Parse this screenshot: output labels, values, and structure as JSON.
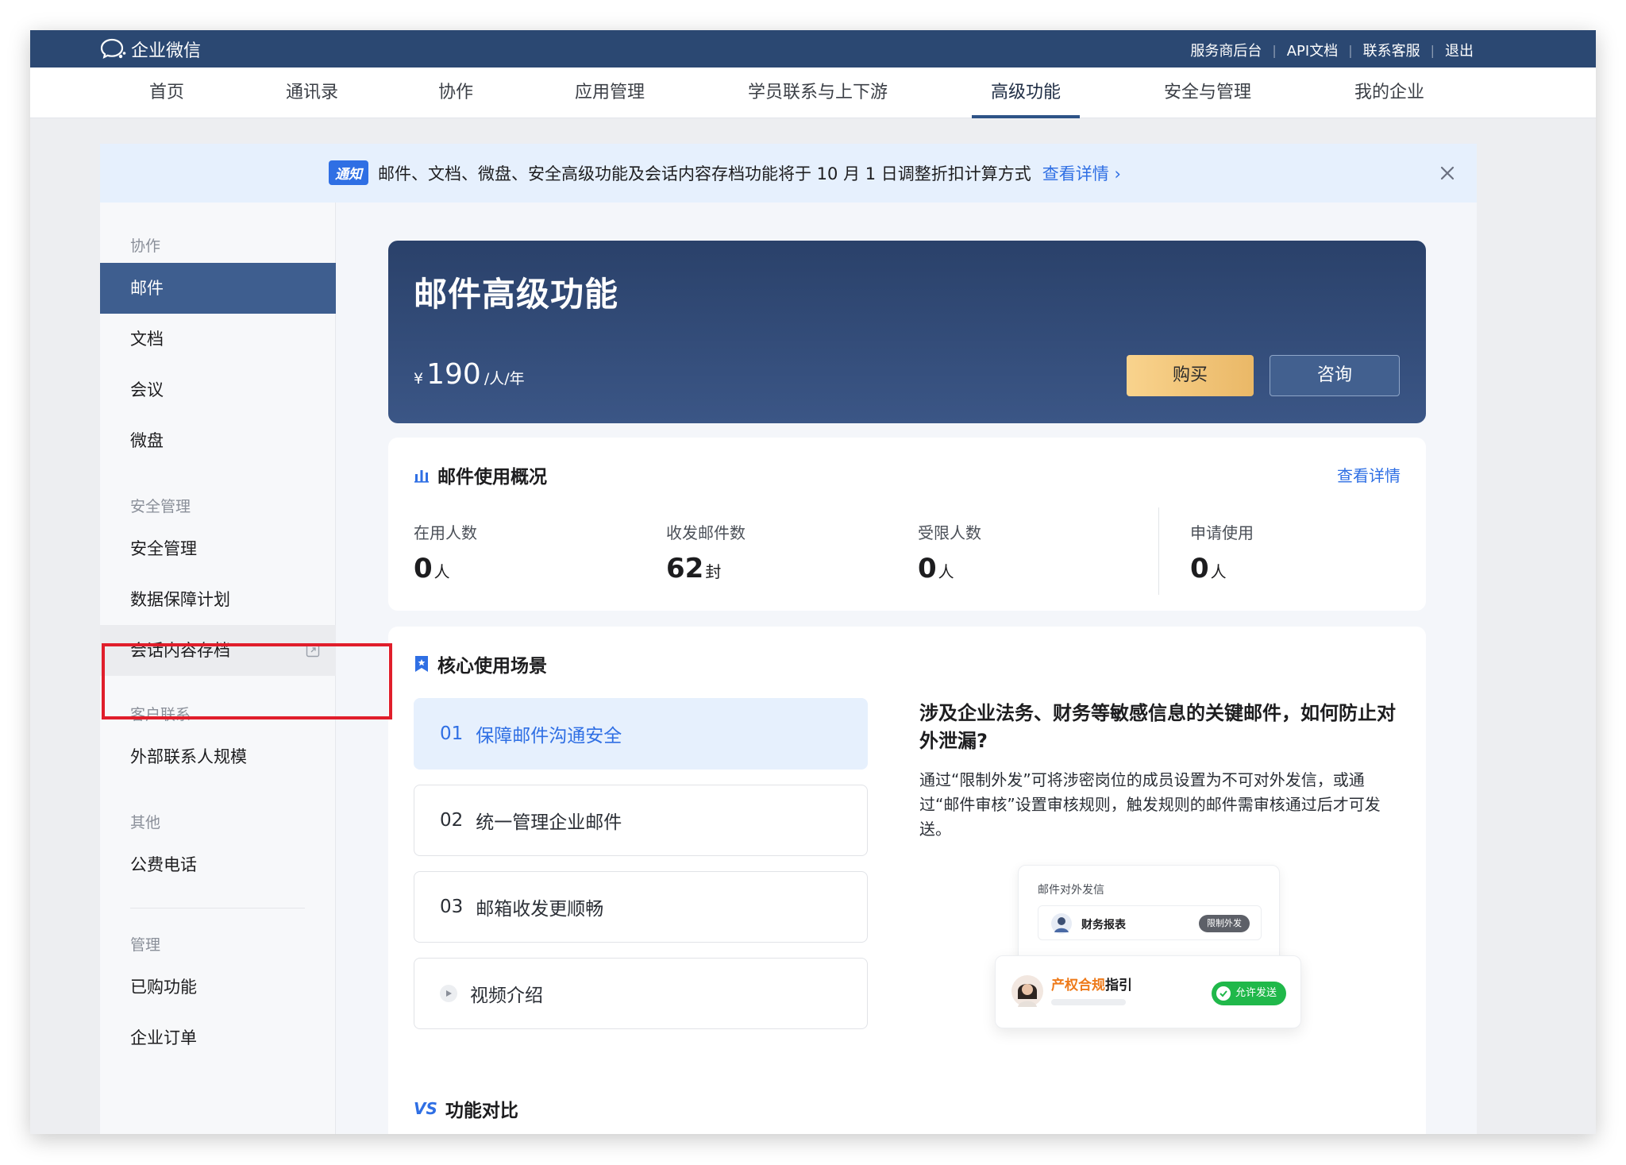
{
  "app": {
    "brand": "企业微信",
    "top_links": [
      "服务商后台",
      "API文档",
      "联系客服",
      "退出"
    ]
  },
  "nav": {
    "items": [
      "首页",
      "通讯录",
      "协作",
      "应用管理",
      "学员联系与上下游",
      "高级功能",
      "安全与管理",
      "我的企业"
    ],
    "active": "高级功能"
  },
  "notice": {
    "badge": "通知",
    "text": "邮件、文档、微盘、安全高级功能及会话内容存档功能将于 10 月 1 日调整折扣计算方式",
    "link": "查看详情"
  },
  "sidebar": {
    "groups": {
      "collab": "协作",
      "security": "安全管理",
      "customer": "客户联系",
      "other": "其他",
      "manage": "管理"
    },
    "items": {
      "mail": "邮件",
      "docs": "文档",
      "meeting": "会议",
      "drive": "微盘",
      "security_mgmt": "安全管理",
      "data_protect": "数据保障计划",
      "archive": "会话内容存档",
      "external_contacts": "外部联系人规模",
      "public_phone": "公费电话",
      "purchased": "已购功能",
      "orders": "企业订单"
    }
  },
  "hero": {
    "title": "邮件高级功能",
    "currency": "¥",
    "price": "190",
    "unit": "/人/年",
    "buy": "购买",
    "consult": "咨询"
  },
  "usage": {
    "title": "邮件使用概况",
    "link": "查看详情",
    "stats": [
      {
        "label": "在用人数",
        "value": "0",
        "unit": "人"
      },
      {
        "label": "收发邮件数",
        "value": "62",
        "unit": "封"
      },
      {
        "label": "受限人数",
        "value": "0",
        "unit": "人"
      },
      {
        "label": "申请使用",
        "value": "0",
        "unit": "人"
      }
    ]
  },
  "scenarios": {
    "title": "核心使用场景",
    "items": [
      {
        "num": "01",
        "label": "保障邮件沟通安全"
      },
      {
        "num": "02",
        "label": "统一管理企业邮件"
      },
      {
        "num": "03",
        "label": "邮箱收发更顺畅"
      }
    ],
    "video": "视频介绍",
    "question": "涉及企业法务、财务等敏感信息的关键邮件，如何防止对外泄漏?",
    "answer": "通过“限制外发”可将涉密岗位的成员设置为不可对外发信，或通过“邮件审核”设置审核规则，触发规则的邮件需审核通过后才可发送。",
    "illus": {
      "card1_title": "邮件对外发信",
      "card1_name": "财务报表",
      "card1_tag": "限制外发",
      "card2_name_orange": "产权合规",
      "card2_name_rest": "指引",
      "card2_tag": "允许发送"
    }
  },
  "compare": {
    "prefix": "VS",
    "title": "功能对比"
  },
  "colors": {
    "topbar": "#2b4872",
    "accent": "#2f6fe4",
    "sidebar_active": "#3e5e8f",
    "hero": "#2f4a76",
    "buy_button": "#f3c67a",
    "highlight_box": "#e01e2b",
    "allow_tag": "#20b84a"
  }
}
